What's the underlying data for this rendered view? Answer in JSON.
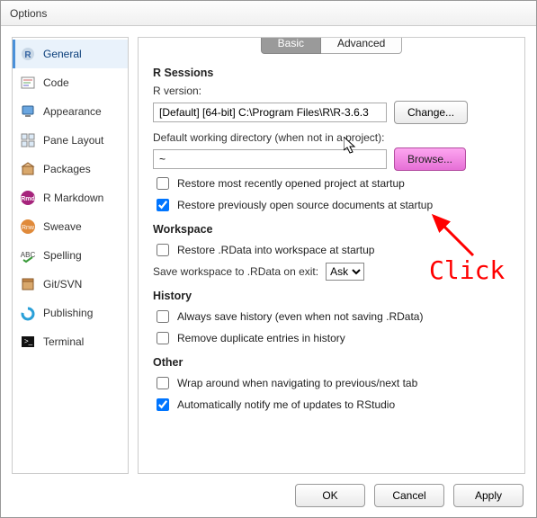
{
  "window": {
    "title": "Options"
  },
  "tabs": {
    "basic": "Basic",
    "advanced": "Advanced",
    "active": "basic"
  },
  "sidebar": {
    "items": [
      {
        "label": "General",
        "icon": "r-logo",
        "selected": true
      },
      {
        "label": "Code",
        "icon": "code"
      },
      {
        "label": "Appearance",
        "icon": "appearance"
      },
      {
        "label": "Pane Layout",
        "icon": "panes"
      },
      {
        "label": "Packages",
        "icon": "packages"
      },
      {
        "label": "R Markdown",
        "icon": "rmd"
      },
      {
        "label": "Sweave",
        "icon": "sweave"
      },
      {
        "label": "Spelling",
        "icon": "spelling"
      },
      {
        "label": "Git/SVN",
        "icon": "git"
      },
      {
        "label": "Publishing",
        "icon": "publish"
      },
      {
        "label": "Terminal",
        "icon": "terminal"
      }
    ]
  },
  "sections": {
    "rsessions": {
      "heading": "R Sessions",
      "rversion_label": "R version:",
      "rversion_value": "[Default] [64-bit] C:\\Program Files\\R\\R-3.6.3",
      "change_btn": "Change...",
      "defaultwd_label": "Default working directory (when not in a project):",
      "defaultwd_value": "~",
      "browse_btn": "Browse...",
      "restore_project": "Restore most recently opened project at startup",
      "restore_project_checked": false,
      "restore_docs": "Restore previously open source documents at startup",
      "restore_docs_checked": true
    },
    "workspace": {
      "heading": "Workspace",
      "restore_rdata": "Restore .RData into workspace at startup",
      "restore_rdata_checked": false,
      "save_label": "Save workspace to .RData on exit:",
      "save_value": "Ask"
    },
    "history": {
      "heading": "History",
      "always_save": "Always save history (even when not saving .RData)",
      "always_save_checked": false,
      "remove_dup": "Remove duplicate entries in history",
      "remove_dup_checked": false
    },
    "other": {
      "heading": "Other",
      "wrap": "Wrap around when navigating to previous/next tab",
      "wrap_checked": false,
      "notify": "Automatically notify me of updates to RStudio",
      "notify_checked": true
    }
  },
  "footer": {
    "ok": "OK",
    "cancel": "Cancel",
    "apply": "Apply"
  },
  "annotation": {
    "text": "Click"
  }
}
